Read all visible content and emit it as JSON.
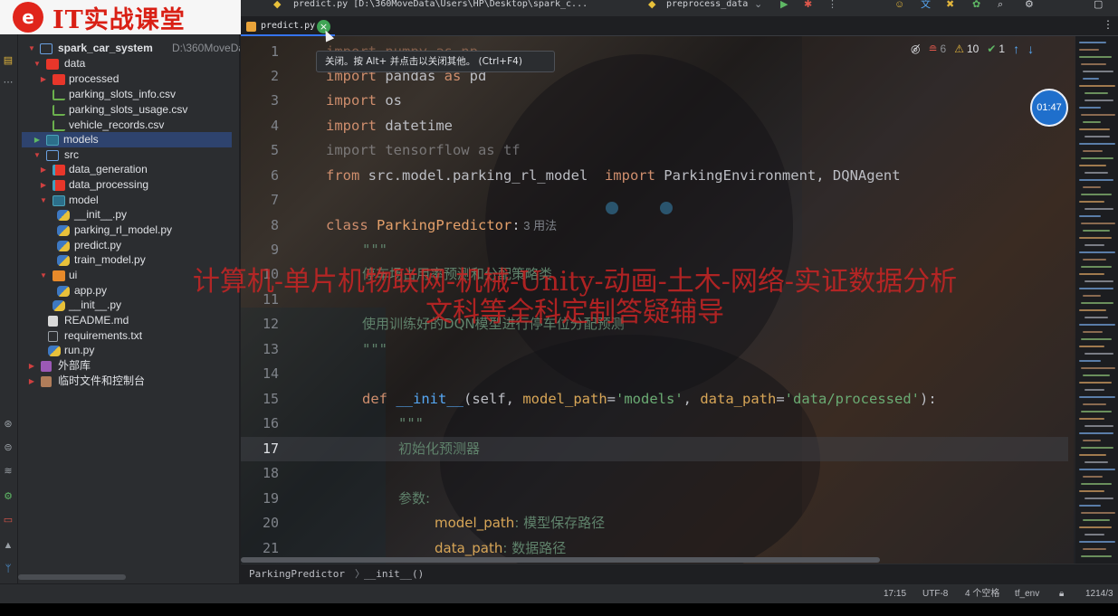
{
  "logo": {
    "glyph": "e",
    "text": "IT实战课堂"
  },
  "topbar": {
    "file_label": "predict.py [D:\\360MoveData\\Users\\HP\\Desktop\\spark_c...",
    "run_config": "preprocess_data"
  },
  "project": {
    "root_name": "spark_car_system",
    "root_path": "D:\\360MoveData",
    "items": [
      {
        "label": "data"
      },
      {
        "label": "processed"
      },
      {
        "label": "parking_slots_info.csv"
      },
      {
        "label": "parking_slots_usage.csv"
      },
      {
        "label": "vehicle_records.csv"
      },
      {
        "label": "models"
      },
      {
        "label": "src"
      },
      {
        "label": "data_generation"
      },
      {
        "label": "data_processing"
      },
      {
        "label": "model"
      },
      {
        "label": "__init__.py"
      },
      {
        "label": "parking_rl_model.py"
      },
      {
        "label": "predict.py"
      },
      {
        "label": "train_model.py"
      },
      {
        "label": "ui"
      },
      {
        "label": "app.py"
      },
      {
        "label": "__init__.py"
      },
      {
        "label": "README.md"
      },
      {
        "label": "requirements.txt"
      },
      {
        "label": "run.py"
      },
      {
        "label": "外部库"
      },
      {
        "label": "临时文件和控制台"
      }
    ]
  },
  "tabs": {
    "active": "predict.py",
    "close_glyph": "×"
  },
  "tooltip": "关闭。按 Alt+ 并点击以关闭其他。 (Ctrl+F4)",
  "inspections": {
    "weak": "6",
    "warnings": "10",
    "ok": "1"
  },
  "timer": "01:47",
  "line_numbers": [
    "1",
    "2",
    "3",
    "4",
    "5",
    "6",
    "7",
    "8",
    "9",
    "10",
    "11",
    "12",
    "13",
    "14",
    "15",
    "16",
    "17",
    "18",
    "19",
    "20",
    "21"
  ],
  "current_line": "17",
  "code": {
    "l1": "import numpy as np",
    "l2_kw": "import",
    "l2_mod": " pandas ",
    "l2_as": "as",
    "l2_alias": " pd",
    "l3_kw": "import",
    "l3_mod": " os",
    "l4_kw": "import",
    "l4_mod": " datetime",
    "l5": "import tensorflow as tf",
    "l6_from": "from",
    "l6_mod": " src.model.parking_rl_model  ",
    "l6_import": "import",
    "l6_names": " ParkingEnvironment, DQNAgent",
    "l8_kw": "class",
    "l8_name": " ParkingPredictor",
    "l8_colon": ":",
    "l8_hint": " 3 用法",
    "l9": "\"\"\"",
    "l10": "停车场占用率预测和分配策略类",
    "l12_a": "使用训练好的",
    "l12_b": "DQN",
    "l12_c": "模型进行停车位分配预测",
    "l13": "\"\"\"",
    "l15_def": "def",
    "l15_name": " __init__",
    "l15_open": "(self, ",
    "l15_p1": "model_path",
    "l15_eq1": "=",
    "l15_s1": "'models'",
    "l15_comma": ", ",
    "l15_p2": "data_path",
    "l15_eq2": "=",
    "l15_s2": "'data/processed'",
    "l15_close": "):",
    "l16": "\"\"\"",
    "l17": "初始化预测器",
    "l19": "参数:",
    "l20_p": "model_path",
    "l20_d": ": 模型保存路径",
    "l21_p": "data_path",
    "l21_d": ": 数据路径"
  },
  "watermark": {
    "line1": "计算机-单片机物联网-机械-Unity-动画-土木-网络-实证数据分析",
    "line2": "文科等全科定制答疑辅导"
  },
  "breadcrumb": {
    "class": "ParkingPredictor",
    "sep": "〉",
    "method": "__init__()"
  },
  "status": {
    "position": "17:15",
    "encoding": "UTF-8",
    "indent": "4 个空格",
    "interpreter": "tf_env",
    "memory": "1214/3"
  }
}
